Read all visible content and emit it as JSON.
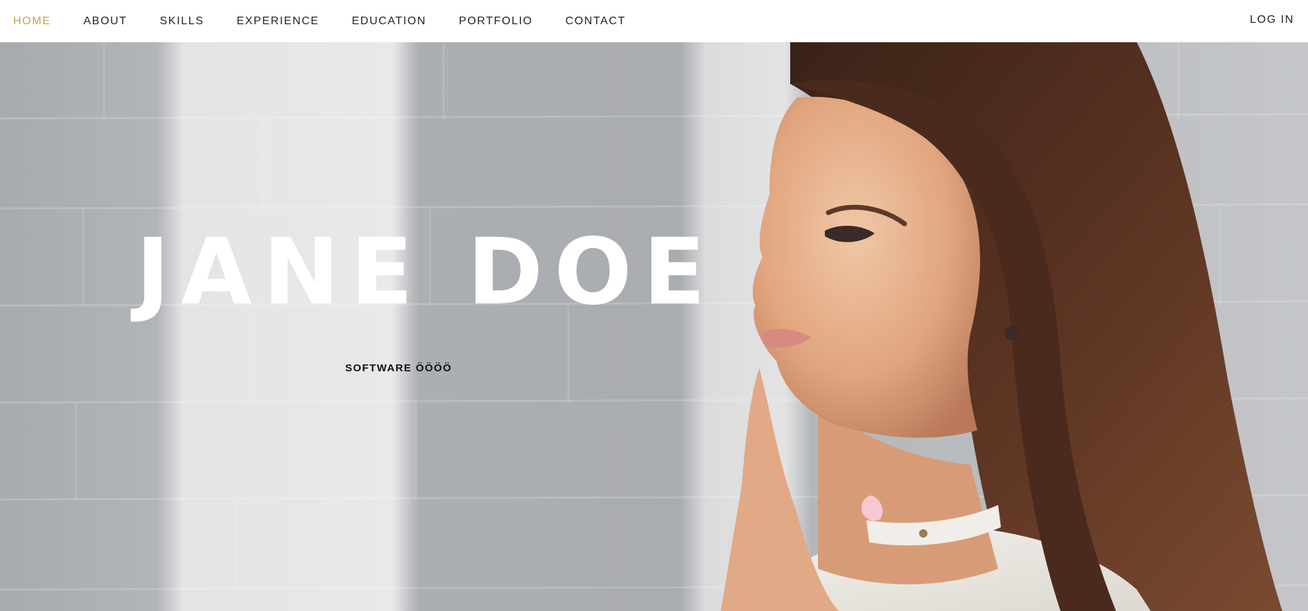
{
  "nav": {
    "items": [
      {
        "label": "HOME",
        "active": true
      },
      {
        "label": "ABOUT",
        "active": false
      },
      {
        "label": "SKILLS",
        "active": false
      },
      {
        "label": "EXPERIENCE",
        "active": false
      },
      {
        "label": "EDUCATION",
        "active": false
      },
      {
        "label": "PORTFOLIO",
        "active": false
      },
      {
        "label": "CONTACT",
        "active": false
      }
    ],
    "login_label": "LOG IN"
  },
  "hero": {
    "title": "JANE DOE",
    "subtitle": "SOFTWARE ÖÖÖÖ"
  },
  "colors": {
    "accent": "#c9a04f",
    "nav_text": "#222222",
    "hero_title": "#ffffff",
    "hero_subtitle": "#111111"
  }
}
